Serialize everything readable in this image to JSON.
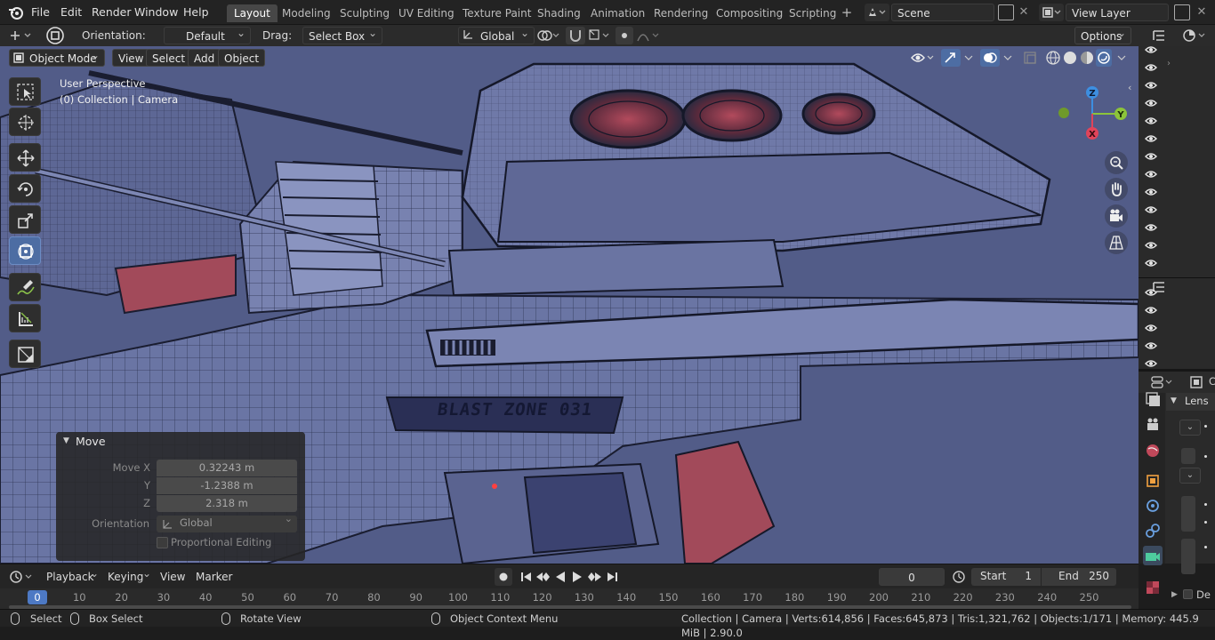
{
  "menu": [
    "File",
    "Edit",
    "Render",
    "Window",
    "Help"
  ],
  "workspace_tabs": [
    "Layout",
    "Modeling",
    "Sculpting",
    "UV Editing",
    "Texture Paint",
    "Shading",
    "Animation",
    "Rendering",
    "Compositing",
    "Scripting"
  ],
  "active_tab": "Layout",
  "scene": {
    "name": "Scene",
    "view_layer": "View Layer"
  },
  "tool_header": {
    "orientation_label": "Orientation:",
    "orientation_value": "Default",
    "drag_label": "Drag:",
    "drag_value": "Select Box",
    "transform_orientation": "Global",
    "options": "Options"
  },
  "viewport_header": {
    "mode": "Object Mode",
    "menus": [
      "View",
      "Select",
      "Add",
      "Object"
    ]
  },
  "viewport": {
    "perspective_label": "User Perspective",
    "collection_label": "(0) Collection | Camera",
    "hull_text": "BLAST ZONE 031",
    "gizmo_axes": {
      "x": "X",
      "y": "Y",
      "z": "Z"
    },
    "colors": {
      "x": "#e0445a",
      "y": "#8cc43a",
      "z": "#3d8ee0",
      "hull": "#6a75a4",
      "accent_red": "#a24a5a"
    }
  },
  "move_panel": {
    "title": "Move",
    "rows": [
      {
        "label": "Move X",
        "value": "0.32243 m"
      },
      {
        "label": "Y",
        "value": "-1.2388 m"
      },
      {
        "label": "Z",
        "value": "2.318 m"
      }
    ],
    "orientation_label": "Orientation",
    "orientation_value": "Global",
    "proportional": "Proportional Editing"
  },
  "properties": {
    "panel_label": "Lens",
    "tab_letter": "C",
    "cut_label": "De"
  },
  "timeline": {
    "menus": [
      "Playback",
      "Keying",
      "View",
      "Marker"
    ],
    "current_frame": "0",
    "start_label": "Start",
    "start": "1",
    "end_label": "End",
    "end": "250",
    "ticks": [
      "0",
      "10",
      "20",
      "30",
      "40",
      "50",
      "60",
      "70",
      "80",
      "90",
      "100",
      "110",
      "120",
      "130",
      "140",
      "150",
      "160",
      "170",
      "180",
      "190",
      "200",
      "210",
      "220",
      "230",
      "240",
      "250"
    ]
  },
  "status": {
    "select": "Select",
    "box_select": "Box Select",
    "rotate_view": "Rotate View",
    "context_menu": "Object Context Menu",
    "stats": "Collection | Camera | Verts:614,856 | Faces:645,873 | Tris:1,321,762 | Objects:1/171 | Memory: 445.9 MiB | 2.90.0"
  }
}
